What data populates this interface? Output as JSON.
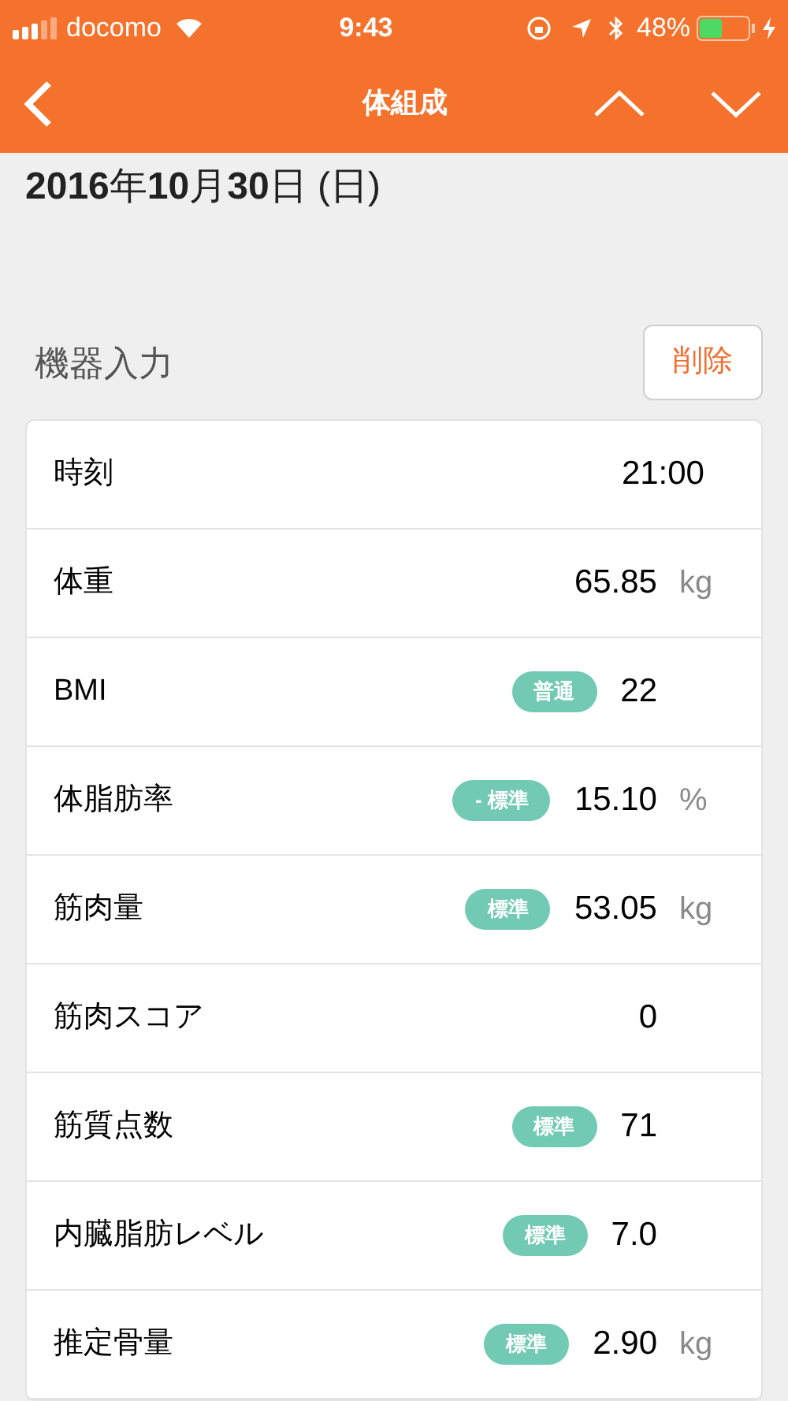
{
  "status_bar": {
    "carrier": "docomo",
    "time": "9:43",
    "battery": "48%"
  },
  "nav": {
    "title": "体組成"
  },
  "date": "**2016**年**10**月**30**日 (日)",
  "section": {
    "title": "機器入力",
    "action": "削除"
  },
  "rows": [
    {
      "kind": "time",
      "label": "時刻",
      "value": "21:00"
    },
    {
      "kind": "measure",
      "label": "体重",
      "value": "65.85",
      "unit": "kg"
    },
    {
      "kind": "measure",
      "label": "BMI",
      "badge": "普通",
      "value": "22"
    },
    {
      "kind": "measure",
      "label": "体脂肪率",
      "badge": "- 標準",
      "value": "15.10",
      "unit": "%"
    },
    {
      "kind": "measure",
      "label": "筋肉量",
      "badge": "標準",
      "value": "53.05",
      "unit": "kg"
    },
    {
      "kind": "measure",
      "label": "筋肉スコア",
      "value": "0"
    },
    {
      "kind": "measure",
      "label": "筋質点数",
      "badge": "標準",
      "value": "71"
    },
    {
      "kind": "measure",
      "label": "内臓脂肪レベル",
      "badge": "標準",
      "value": "7.0"
    },
    {
      "kind": "measure",
      "label": "推定骨量",
      "badge": "標準",
      "value": "2.90",
      "unit": "kg"
    }
  ]
}
